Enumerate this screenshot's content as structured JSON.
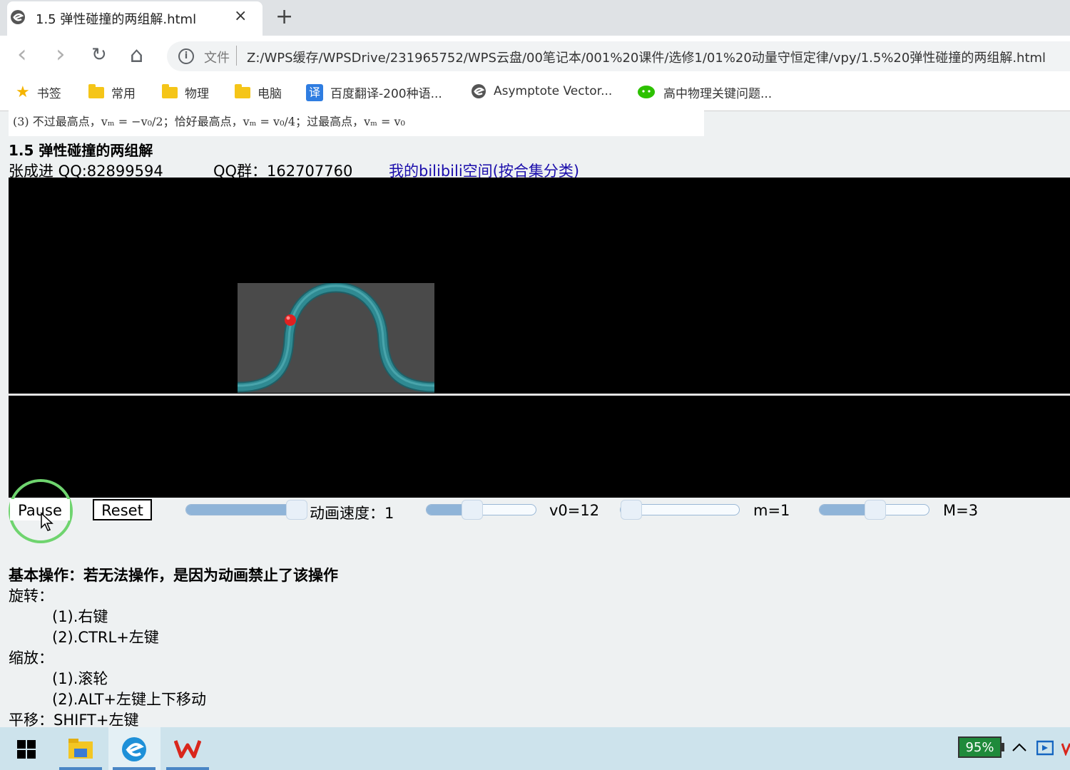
{
  "browser": {
    "tab_title": "1.5 弹性碰撞的两组解.html",
    "tab_close": "×",
    "new_tab": "+",
    "nav": {
      "back": "‹",
      "forward": "›",
      "reload": "↻",
      "home": "⌂"
    },
    "address": {
      "scheme_label": "文件",
      "url": "Z:/WPS缓存/WPSDrive/231965752/WPS云盘/00笔记本/001%20课件/选修1/01%20动量守恒定律/vpy/1.5%20弹性碰撞的两组解.html"
    },
    "bookmarks": [
      {
        "label": "书签",
        "icon": "star-icon"
      },
      {
        "label": "常用",
        "icon": "folder-icon"
      },
      {
        "label": "物理",
        "icon": "folder-icon"
      },
      {
        "label": "电脑",
        "icon": "folder-icon"
      },
      {
        "label": "百度翻译-200种语...",
        "icon": "translate-icon",
        "badge": "译"
      },
      {
        "label": "Asymptote Vector...",
        "icon": "site-icon"
      },
      {
        "label": "高中物理关键问题...",
        "icon": "wechat-icon"
      }
    ]
  },
  "page": {
    "formula_line": "(3) 不过最高点，vₘ = −v₀/2；恰好最高点，vₘ = v₀/4；过最高点，vₘ = v₀",
    "title": "1.5 弹性碰撞的两组解",
    "author": "张成进  QQ:82899594",
    "qq_group": "QQ群：162707760",
    "bili_link": "我的bilibili空间(按合集分类)"
  },
  "controls": {
    "pause_label": "Pause",
    "reset_label": "Reset",
    "sliders": [
      {
        "name": "speed",
        "label": "动画速度：1",
        "fraction": 1.0
      },
      {
        "name": "v0",
        "label": "v0=12",
        "fraction": 0.39
      },
      {
        "name": "m",
        "label": "m=1",
        "fraction": 0.0
      },
      {
        "name": "M",
        "label": "M=3",
        "fraction": 0.5
      }
    ]
  },
  "help": {
    "heading": "基本操作：若无法操作，是因为动画禁止了该操作",
    "rotate": "旋转：",
    "rotate_1": "(1).右键",
    "rotate_2": "(2).CTRL+左键",
    "zoom": "缩放：",
    "zoom_1": "(1).滚轮",
    "zoom_2": "(2).ALT+左键上下移动",
    "pan": "平移：SHIFT+左键"
  },
  "taskbar": {
    "battery": "95%",
    "tray_chevron": "^"
  },
  "colors": {
    "track": "#2f8a92",
    "ball": "#e02020",
    "block": "#4a4a4a",
    "accent_ring": "#6fd46f"
  }
}
